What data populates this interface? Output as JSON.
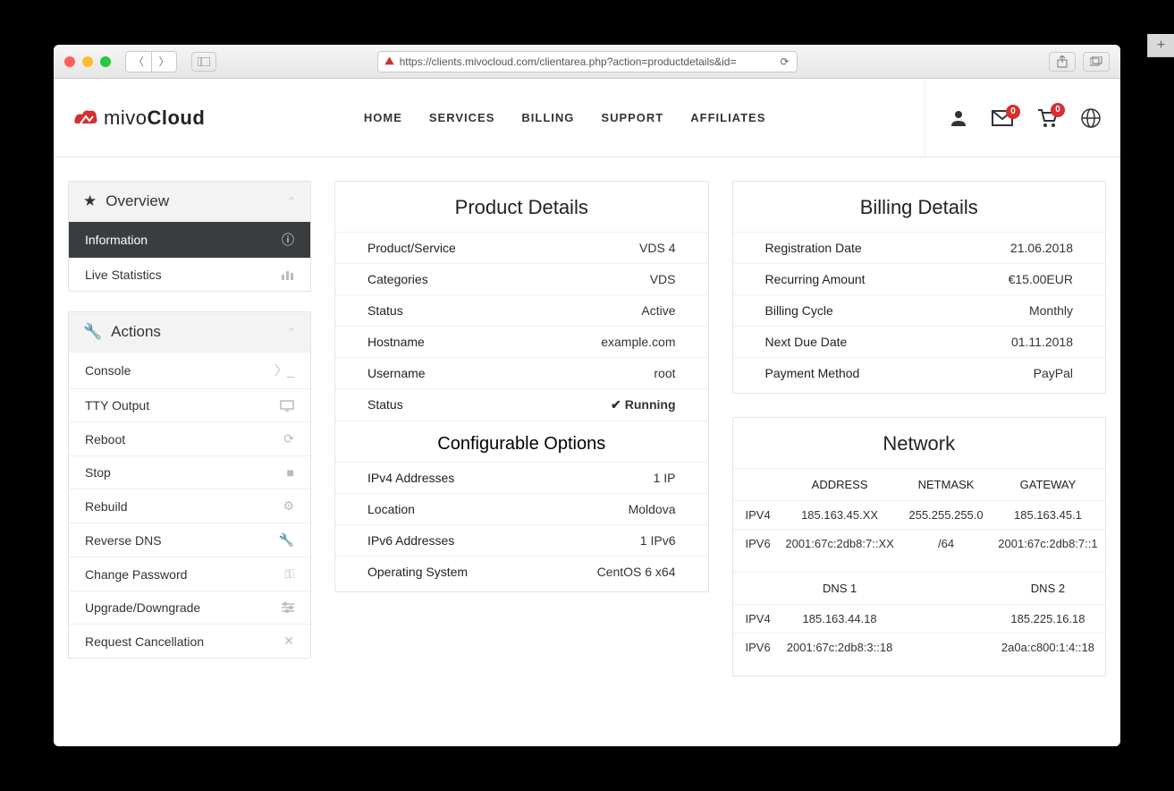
{
  "browser": {
    "url": "https://clients.mivocloud.com/clientarea.php?action=productdetails&id="
  },
  "logo": {
    "brand_prefix": "mivo",
    "brand_suffix": "Cloud"
  },
  "nav": {
    "home": "HOME",
    "services": "SERVICES",
    "billing": "BILLING",
    "support": "SUPPORT",
    "affiliates": "AFFILIATES"
  },
  "header_badges": {
    "mail": "0",
    "cart": "0"
  },
  "sidebar": {
    "overview": {
      "title": "Overview",
      "items": [
        {
          "label": "Information",
          "icon": "info-icon",
          "active": true
        },
        {
          "label": "Live Statistics",
          "icon": "chart-icon",
          "active": false
        }
      ]
    },
    "actions": {
      "title": "Actions",
      "items": [
        {
          "label": "Console",
          "icon": "terminal-icon"
        },
        {
          "label": "TTY Output",
          "icon": "monitor-icon"
        },
        {
          "label": "Reboot",
          "icon": "refresh-icon"
        },
        {
          "label": "Stop",
          "icon": "stop-icon"
        },
        {
          "label": "Rebuild",
          "icon": "gears-icon"
        },
        {
          "label": "Reverse DNS",
          "icon": "wrench-icon"
        },
        {
          "label": "Change Password",
          "icon": "key-icon"
        },
        {
          "label": "Upgrade/Downgrade",
          "icon": "sliders-icon"
        },
        {
          "label": "Request Cancellation",
          "icon": "x-icon"
        }
      ]
    }
  },
  "product": {
    "title": "Product Details",
    "rows": {
      "product_service": {
        "k": "Product/Service",
        "v": "VDS 4"
      },
      "categories": {
        "k": "Categories",
        "v": "VDS"
      },
      "status1": {
        "k": "Status",
        "v": "Active"
      },
      "hostname": {
        "k": "Hostname",
        "v": "example.com"
      },
      "username": {
        "k": "Username",
        "v": "root"
      },
      "status2": {
        "k": "Status",
        "v": "Running"
      }
    }
  },
  "config": {
    "title": "Configurable Options",
    "rows": {
      "ipv4": {
        "k": "IPv4 Addresses",
        "v": "1 IP"
      },
      "loc": {
        "k": "Location",
        "v": "Moldova"
      },
      "ipv6": {
        "k": "IPv6 Addresses",
        "v": "1 IPv6"
      },
      "os": {
        "k": "Operating System",
        "v": "CentOS 6 x64"
      }
    }
  },
  "billing": {
    "title": "Billing Details",
    "rows": {
      "reg": {
        "k": "Registration Date",
        "v": "21.06.2018"
      },
      "amt": {
        "k": "Recurring Amount",
        "v": "€15.00EUR"
      },
      "cycle": {
        "k": "Billing Cycle",
        "v": "Monthly"
      },
      "due": {
        "k": "Next Due Date",
        "v": "01.11.2018"
      },
      "pm": {
        "k": "Payment Method",
        "v": "PayPal"
      }
    }
  },
  "network": {
    "title": "Network",
    "headers": {
      "addr": "ADDRESS",
      "mask": "NETMASK",
      "gw": "GATEWAY"
    },
    "rows": {
      "ipv4": {
        "lbl": "IPV4",
        "addr": "185.163.45.XX",
        "mask": "255.255.255.0",
        "gw": "185.163.45.1"
      },
      "ipv6": {
        "lbl": "IPV6",
        "addr": "2001:67c:2db8:7::XX",
        "mask": "/64",
        "gw": "2001:67c:2db8:7::1"
      }
    },
    "dns_headers": {
      "d1": "DNS 1",
      "d2": "DNS 2"
    },
    "dns": {
      "ipv4": {
        "lbl": "IPV4",
        "d1": "185.163.44.18",
        "d2": "185.225.16.18"
      },
      "ipv6": {
        "lbl": "IPV6",
        "d1": "2001:67c:2db8:3::18",
        "d2": "2a0a:c800:1:4::18"
      }
    }
  }
}
